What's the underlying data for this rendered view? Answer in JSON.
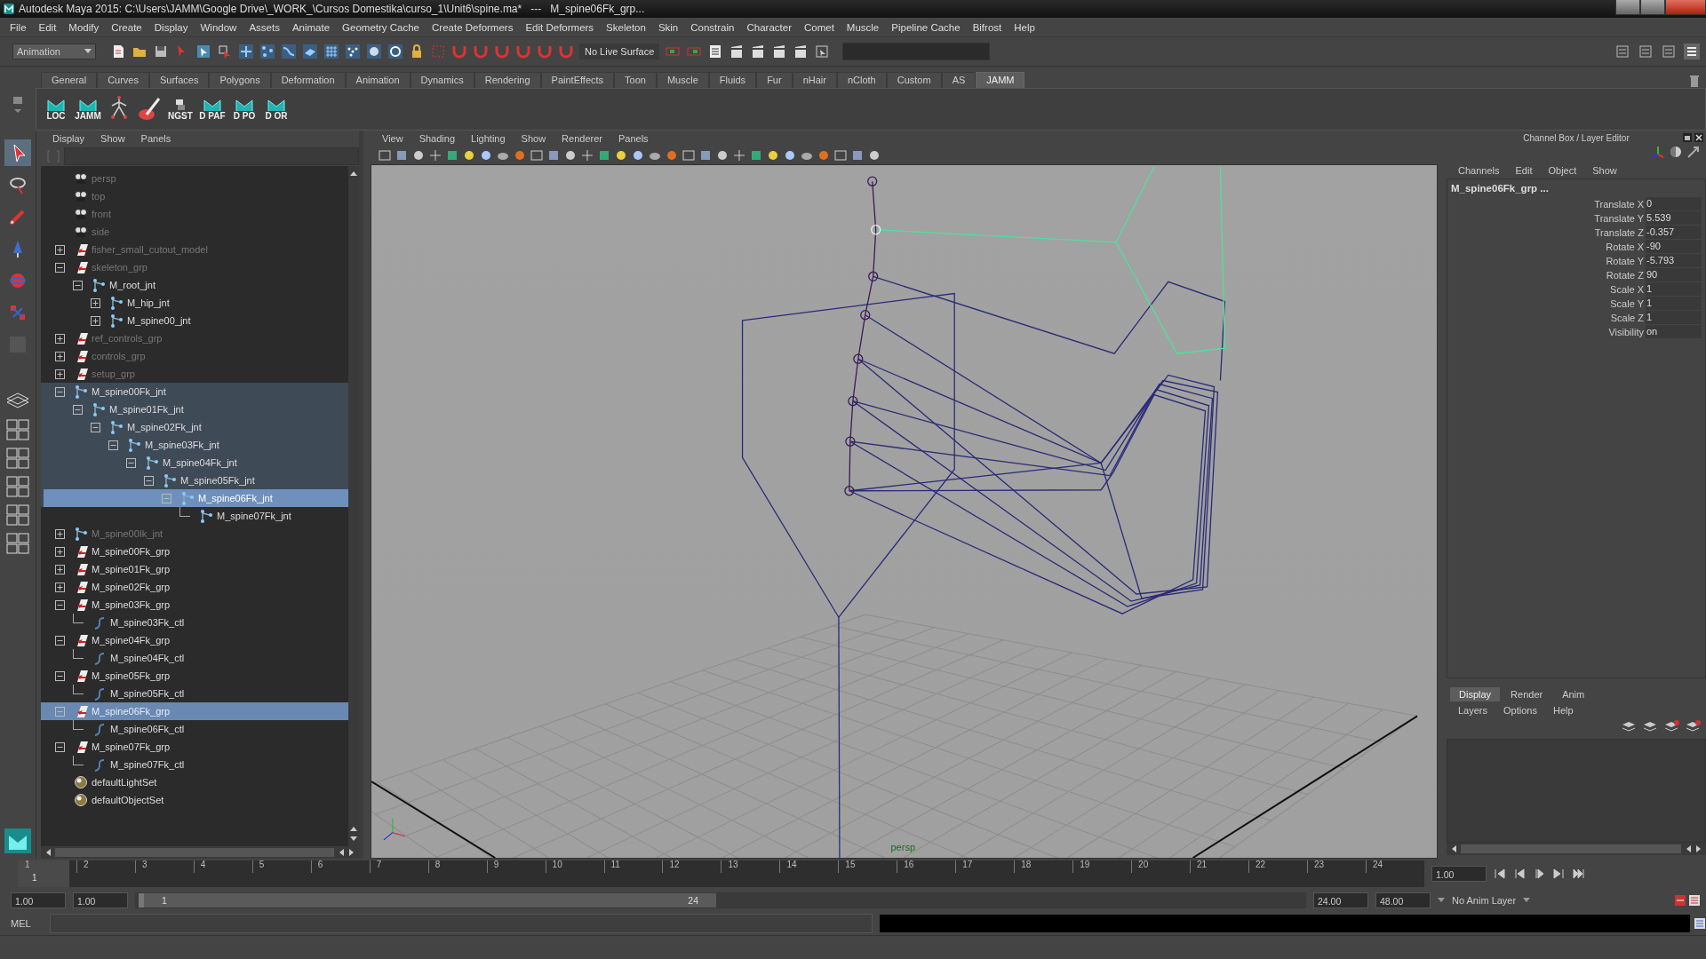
{
  "window": {
    "title": "Autodesk Maya 2015: C:\\Users\\JAMM\\Google Drive\\_WORK_\\Cursos Domestika\\curso_1\\Unit6\\spine.ma*   ---   M_spine06Fk_grp..."
  },
  "menu_bar": [
    "File",
    "Edit",
    "Modify",
    "Create",
    "Display",
    "Window",
    "Assets",
    "Animate",
    "Geometry Cache",
    "Create Deformers",
    "Edit Deformers",
    "Skeleton",
    "Skin",
    "Constrain",
    "Character",
    "Comet",
    "Muscle",
    "Pipeline Cache",
    "Bifrost",
    "Help"
  ],
  "status_line": {
    "menu_set": "Animation",
    "live_surface": "No Live Surface"
  },
  "shelf_tabs": [
    {
      "label": "General",
      "selected": false
    },
    {
      "label": "Curves",
      "selected": false
    },
    {
      "label": "Surfaces",
      "selected": false
    },
    {
      "label": "Polygons",
      "selected": false
    },
    {
      "label": "Deformation",
      "selected": false
    },
    {
      "label": "Animation",
      "selected": false
    },
    {
      "label": "Dynamics",
      "selected": false
    },
    {
      "label": "Rendering",
      "selected": false
    },
    {
      "label": "PaintEffects",
      "selected": false
    },
    {
      "label": "Toon",
      "selected": false
    },
    {
      "label": "Muscle",
      "selected": false
    },
    {
      "label": "Fluids",
      "selected": false
    },
    {
      "label": "Fur",
      "selected": false
    },
    {
      "label": "nHair",
      "selected": false
    },
    {
      "label": "nCloth",
      "selected": false
    },
    {
      "label": "Custom",
      "selected": false
    },
    {
      "label": "AS",
      "selected": false
    },
    {
      "label": "JAMM",
      "selected": true
    }
  ],
  "shelf_buttons": [
    {
      "kind": "script",
      "label": "LOC"
    },
    {
      "kind": "script",
      "label": "JAMM"
    },
    {
      "kind": "skeleton"
    },
    {
      "kind": "brush"
    },
    {
      "kind": "python",
      "label": "NGST"
    },
    {
      "kind": "script",
      "label": "D PAF"
    },
    {
      "kind": "script",
      "label": "D PO"
    },
    {
      "kind": "script",
      "label": "D OR"
    }
  ],
  "outliner": {
    "menus": [
      "Display",
      "Show",
      "Panels"
    ],
    "items": [
      {
        "label": "persp",
        "kind": "camera",
        "dimmed": true,
        "highlighted": false,
        "selected": false
      },
      {
        "label": "top",
        "kind": "camera",
        "dimmed": true,
        "highlighted": false,
        "selected": false
      },
      {
        "label": "front",
        "kind": "camera",
        "dimmed": true,
        "highlighted": false,
        "selected": false
      },
      {
        "label": "side",
        "kind": "camera",
        "dimmed": true,
        "highlighted": false,
        "selected": false
      },
      {
        "label": "fisher_small_cutout_model",
        "kind": "group",
        "dimmed": true,
        "highlighted": false,
        "selected": false,
        "expanded": false
      },
      {
        "label": "skeleton_grp",
        "kind": "group",
        "dimmed": true,
        "highlighted": false,
        "selected": false,
        "expanded": true,
        "children": [
          {
            "label": "M_root_jnt",
            "kind": "joint",
            "dimmed": false,
            "highlighted": false,
            "selected": false,
            "expanded": true,
            "children": [
              {
                "label": "M_hip_jnt",
                "kind": "joint",
                "dimmed": false,
                "highlighted": false,
                "selected": false,
                "expanded": false
              },
              {
                "label": "M_spine00_jnt",
                "kind": "joint",
                "dimmed": false,
                "highlighted": false,
                "selected": false,
                "expanded": false
              }
            ]
          }
        ]
      },
      {
        "label": "ref_controls_grp",
        "kind": "group",
        "dimmed": true,
        "highlighted": false,
        "selected": false,
        "expanded": false
      },
      {
        "label": "controls_grp",
        "kind": "group",
        "dimmed": true,
        "highlighted": false,
        "selected": false,
        "expanded": false
      },
      {
        "label": "setup_grp",
        "kind": "group",
        "dimmed": true,
        "highlighted": false,
        "selected": false,
        "expanded": false
      },
      {
        "label": "M_spine00Fk_jnt",
        "kind": "joint",
        "dimmed": false,
        "highlighted": true,
        "selected": false,
        "expanded": true,
        "children": [
          {
            "label": "M_spine01Fk_jnt",
            "kind": "joint",
            "dimmed": false,
            "highlighted": true,
            "selected": false,
            "expanded": true,
            "children": [
              {
                "label": "M_spine02Fk_jnt",
                "kind": "joint",
                "dimmed": false,
                "highlighted": true,
                "selected": false,
                "expanded": true,
                "children": [
                  {
                    "label": "M_spine03Fk_jnt",
                    "kind": "joint",
                    "dimmed": false,
                    "highlighted": true,
                    "selected": false,
                    "expanded": true,
                    "children": [
                      {
                        "label": "M_spine04Fk_jnt",
                        "kind": "joint",
                        "dimmed": false,
                        "highlighted": true,
                        "selected": false,
                        "expanded": true,
                        "children": [
                          {
                            "label": "M_spine05Fk_jnt",
                            "kind": "joint",
                            "dimmed": false,
                            "highlighted": true,
                            "selected": false,
                            "expanded": true,
                            "children": [
                              {
                                "label": "M_spine06Fk_jnt",
                                "kind": "joint",
                                "dimmed": false,
                                "highlighted": true,
                                "selected": true,
                                "expanded": true,
                                "children": [
                                  {
                                    "label": "M_spine07Fk_jnt",
                                    "kind": "joint",
                                    "dimmed": false,
                                    "highlighted": false,
                                    "selected": false
                                  }
                                ]
                              }
                            ]
                          }
                        ]
                      }
                    ]
                  }
                ]
              }
            ]
          }
        ]
      },
      {
        "label": "M_spine00Ik_jnt",
        "kind": "joint",
        "dimmed": true,
        "highlighted": false,
        "selected": false,
        "expanded": false
      },
      {
        "label": "M_spine00Fk_grp",
        "kind": "group",
        "dimmed": false,
        "highlighted": false,
        "selected": false,
        "expanded": false
      },
      {
        "label": "M_spine01Fk_grp",
        "kind": "group",
        "dimmed": false,
        "highlighted": false,
        "selected": false,
        "expanded": false
      },
      {
        "label": "M_spine02Fk_grp",
        "kind": "group",
        "dimmed": false,
        "highlighted": false,
        "selected": false,
        "expanded": false
      },
      {
        "label": "M_spine03Fk_grp",
        "kind": "group",
        "dimmed": false,
        "highlighted": false,
        "selected": false,
        "expanded": true,
        "children": [
          {
            "label": "M_spine03Fk_ctl",
            "kind": "curve",
            "dimmed": false,
            "highlighted": false,
            "selected": false
          }
        ]
      },
      {
        "label": "M_spine04Fk_grp",
        "kind": "group",
        "dimmed": false,
        "highlighted": false,
        "selected": false,
        "expanded": true,
        "children": [
          {
            "label": "M_spine04Fk_ctl",
            "kind": "curve",
            "dimmed": false,
            "highlighted": false,
            "selected": false
          }
        ]
      },
      {
        "label": "M_spine05Fk_grp",
        "kind": "group",
        "dimmed": false,
        "highlighted": false,
        "selected": false,
        "expanded": true,
        "children": [
          {
            "label": "M_spine05Fk_ctl",
            "kind": "curve",
            "dimmed": false,
            "highlighted": false,
            "selected": false
          }
        ]
      },
      {
        "label": "M_spine06Fk_grp",
        "kind": "group",
        "dimmed": false,
        "highlighted": false,
        "selected": true,
        "expanded": true,
        "children": [
          {
            "label": "M_spine06Fk_ctl",
            "kind": "curve",
            "dimmed": false,
            "highlighted": false,
            "selected": false
          }
        ]
      },
      {
        "label": "M_spine07Fk_grp",
        "kind": "group",
        "dimmed": false,
        "highlighted": false,
        "selected": false,
        "expanded": true,
        "children": [
          {
            "label": "M_spine07Fk_ctl",
            "kind": "curve",
            "dimmed": false,
            "highlighted": false,
            "selected": false
          }
        ]
      },
      {
        "label": "defaultLightSet",
        "kind": "set",
        "dimmed": false,
        "highlighted": false,
        "selected": false
      },
      {
        "label": "defaultObjectSet",
        "kind": "set",
        "dimmed": false,
        "highlighted": false,
        "selected": false
      }
    ]
  },
  "viewport": {
    "menus": [
      "View",
      "Shading",
      "Lighting",
      "Show",
      "Renderer",
      "Panels"
    ],
    "camera_label": "persp"
  },
  "channel_box": {
    "title": "Channel Box / Layer Editor",
    "menus": [
      "Channels",
      "Edit",
      "Object",
      "Show"
    ],
    "object": "M_spine06Fk_grp ...",
    "channels": [
      {
        "name": "Translate X",
        "value": "0"
      },
      {
        "name": "Translate Y",
        "value": "5.539"
      },
      {
        "name": "Translate Z",
        "value": "-0.357"
      },
      {
        "name": "Rotate X",
        "value": "-90"
      },
      {
        "name": "Rotate Y",
        "value": "-5.793"
      },
      {
        "name": "Rotate Z",
        "value": "90"
      },
      {
        "name": "Scale X",
        "value": "1"
      },
      {
        "name": "Scale Y",
        "value": "1"
      },
      {
        "name": "Scale Z",
        "value": "1"
      },
      {
        "name": "Visibility",
        "value": "on"
      }
    ]
  },
  "layer_editor": {
    "tabs": [
      {
        "label": "Display",
        "selected": true
      },
      {
        "label": "Render",
        "selected": false
      },
      {
        "label": "Anim",
        "selected": false
      }
    ],
    "menus": [
      "Layers",
      "Options",
      "Help"
    ]
  },
  "time_slider": {
    "frames": [
      "1",
      "2",
      "3",
      "4",
      "5",
      "6",
      "7",
      "8",
      "9",
      "10",
      "11",
      "12",
      "13",
      "14",
      "15",
      "16",
      "17",
      "18",
      "19",
      "20",
      "21",
      "22",
      "23",
      "24"
    ],
    "current_frame": "1",
    "current_time": "1.00"
  },
  "range_slider": {
    "start": "1.00",
    "playback_start": "1.00",
    "range_start": "1",
    "range_end": "24",
    "playback_end": "24.00",
    "end": "48.00",
    "anim_layer": "No Anim Layer"
  },
  "command_line": {
    "language": "MEL"
  }
}
